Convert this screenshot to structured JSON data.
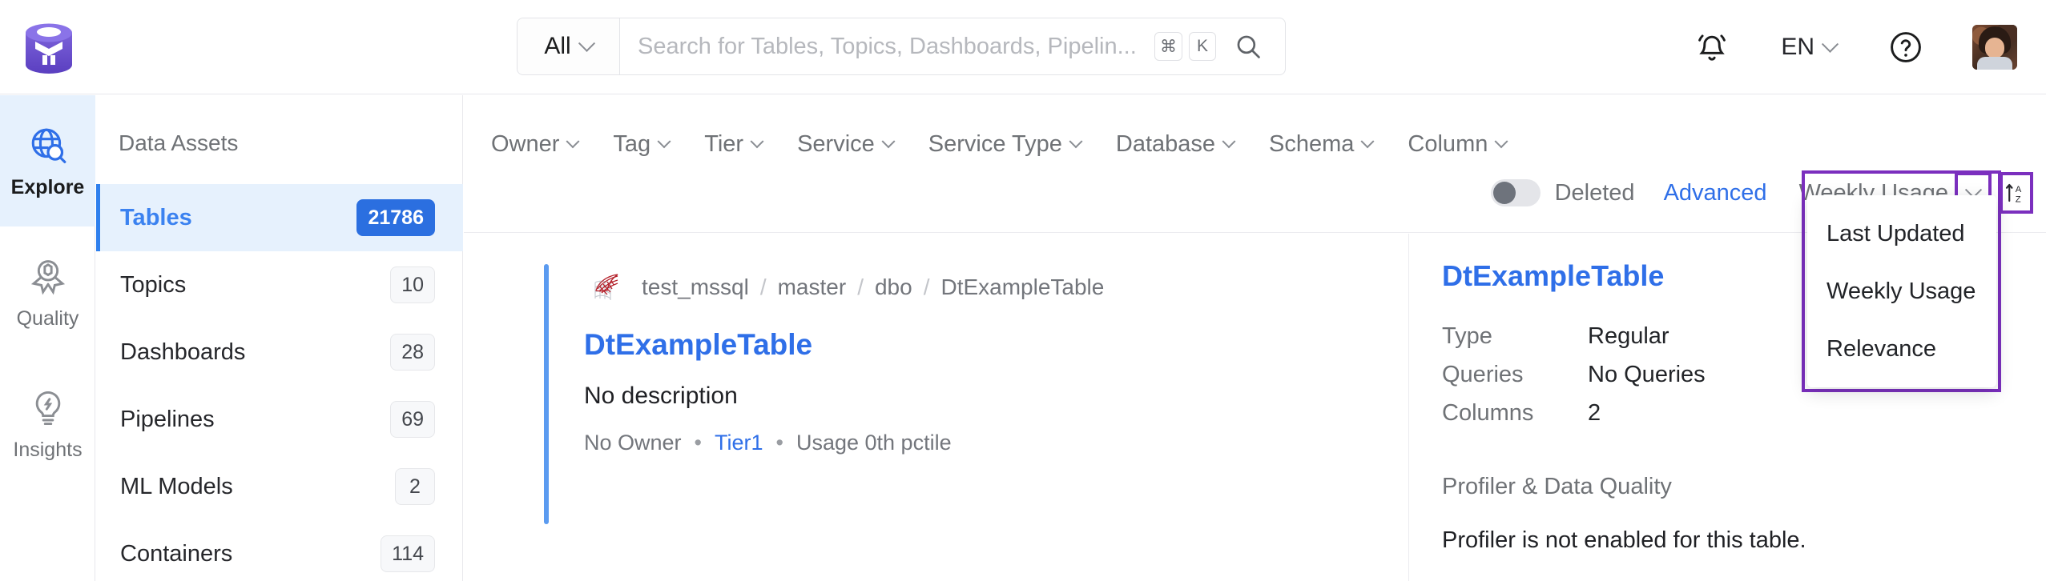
{
  "header": {
    "logo_icon": "openmetadata-logo",
    "search": {
      "scope_label": "All",
      "scope_chevron_icon": "chevron-down-icon",
      "placeholder": "Search for Tables, Topics, Dashboards, Pipelin...",
      "value": "",
      "kbd_cmd": "⌘",
      "kbd_key": "K",
      "search_icon": "search-icon"
    },
    "notifications_icon": "bell-icon",
    "language": {
      "label": "EN",
      "chevron_icon": "chevron-down-icon"
    },
    "help_icon": "question-circle-icon",
    "avatar_icon": "user-avatar"
  },
  "rail": {
    "items": [
      {
        "label": "Explore",
        "icon": "globe-search-icon",
        "active": true
      },
      {
        "label": "Quality",
        "icon": "award-ribbon-icon",
        "active": false
      },
      {
        "label": "Insights",
        "icon": "lightbulb-icon",
        "active": false
      }
    ]
  },
  "sidebar": {
    "title": "Data Assets",
    "items": [
      {
        "label": "Tables",
        "count": "21786",
        "active": true
      },
      {
        "label": "Topics",
        "count": "10",
        "active": false
      },
      {
        "label": "Dashboards",
        "count": "28",
        "active": false
      },
      {
        "label": "Pipelines",
        "count": "69",
        "active": false
      },
      {
        "label": "ML Models",
        "count": "2",
        "active": false
      },
      {
        "label": "Containers",
        "count": "114",
        "active": false
      }
    ]
  },
  "filters": {
    "items": [
      {
        "label": "Owner"
      },
      {
        "label": "Tag"
      },
      {
        "label": "Tier"
      },
      {
        "label": "Service"
      },
      {
        "label": "Service Type"
      },
      {
        "label": "Database"
      },
      {
        "label": "Schema"
      },
      {
        "label": "Column"
      }
    ],
    "deleted_toggle": {
      "label": "Deleted",
      "on": false
    },
    "advanced_label": "Advanced",
    "sort": {
      "selected": "Weekly Usage",
      "chevron_icon": "chevron-down-icon",
      "order_icon": "sort-az-icon",
      "options": [
        "Last Updated",
        "Weekly Usage",
        "Relevance"
      ]
    }
  },
  "results": {
    "cards": [
      {
        "service_icon": "mssql-icon",
        "breadcrumb": [
          "test_mssql",
          "master",
          "dbo",
          "DtExampleTable"
        ],
        "separator": "/",
        "title": "DtExampleTable",
        "description": "No description",
        "owner": "No Owner",
        "tier": "Tier1",
        "usage": "Usage 0th pctile",
        "dot": "•"
      }
    ]
  },
  "summary": {
    "title": "DtExampleTable",
    "rows": [
      {
        "key": "Type",
        "value": "Regular"
      },
      {
        "key": "Queries",
        "value": "No Queries"
      },
      {
        "key": "Columns",
        "value": "2"
      }
    ],
    "section_title": "Profiler & Data Quality",
    "section_note": "Profiler is not enabled for this table."
  },
  "colors": {
    "brand_purple": "#7b2fbe",
    "link_blue": "#2f6fe8",
    "accent_blue": "#5b9bf0",
    "active_bg": "#e6f1fd",
    "badge_blue": "#2b6fe0"
  }
}
